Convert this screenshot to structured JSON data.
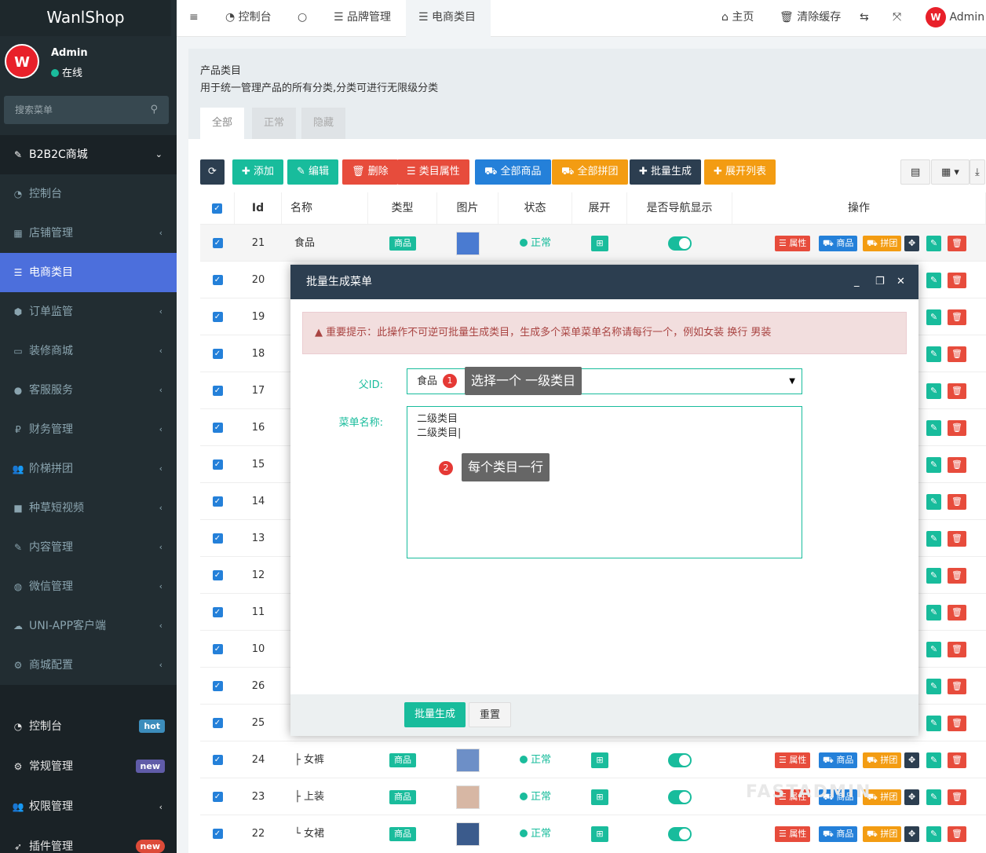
{
  "sidebar": {
    "logo": "WanlShop",
    "avatar_letter": "W",
    "user_name": "Admin",
    "user_status": "在线",
    "search_placeholder": "搜索菜单",
    "header_item": "B2B2C商城",
    "items": [
      {
        "label": "控制台",
        "icon": "dashboard-icon"
      },
      {
        "label": "店铺管理",
        "icon": "store-icon"
      },
      {
        "label": "电商类目",
        "icon": "list-icon",
        "active": true
      },
      {
        "label": "订单监管",
        "icon": "order-icon"
      },
      {
        "label": "装修商城",
        "icon": "monitor-icon"
      },
      {
        "label": "客服服务",
        "icon": "chat-icon"
      },
      {
        "label": "财务管理",
        "icon": "finance-icon"
      },
      {
        "label": "阶梯拼团",
        "icon": "group-icon"
      },
      {
        "label": "种草短视频",
        "icon": "video-icon"
      },
      {
        "label": "内容管理",
        "icon": "edit-icon"
      },
      {
        "label": "微信管理",
        "icon": "wechat-icon"
      },
      {
        "label": "UNI-APP客户端",
        "icon": "cloud-icon"
      },
      {
        "label": "商城配置",
        "icon": "gear-icon"
      }
    ],
    "lower_items": [
      {
        "label": "控制台",
        "badge": "hot",
        "badge_color": "#3c8dbc"
      },
      {
        "label": "常规管理",
        "badge": "new",
        "badge_color": "#605ca8"
      },
      {
        "label": "权限管理",
        "badge": "",
        "badge_color": ""
      },
      {
        "label": "插件管理",
        "badge": "new",
        "badge_color": "#dd4b39"
      }
    ]
  },
  "topbar": {
    "tabs": [
      "控制台",
      "",
      "品牌管理",
      "电商类目"
    ],
    "right": [
      "主页",
      "清除缓存"
    ],
    "user": "Admin"
  },
  "page": {
    "title": "产品类目",
    "description": "用于统一管理产品的所有分类,分类可进行无限级分类",
    "tabs": [
      "全部",
      "正常",
      "隐藏"
    ]
  },
  "toolbar": {
    "add": "添加",
    "edit": "编辑",
    "delete": "删除",
    "attr": "类目属性",
    "all_goods": "全部商品",
    "all_group": "全部拼团",
    "batch": "批量生成",
    "expand": "展开列表"
  },
  "table": {
    "headers": [
      "Id",
      "名称",
      "类型",
      "图片",
      "状态",
      "展开",
      "是否导航显示",
      "操作"
    ],
    "ops": {
      "attr": "属性",
      "goods": "商品",
      "group": "拼团"
    },
    "rows": [
      {
        "id": "21",
        "name": "食品",
        "type": "商品",
        "status": "正常"
      },
      {
        "id": "20",
        "name": "",
        "type": "",
        "status": ""
      },
      {
        "id": "19",
        "name": "",
        "type": "",
        "status": ""
      },
      {
        "id": "18",
        "name": "",
        "type": "",
        "status": ""
      },
      {
        "id": "17",
        "name": "",
        "type": "",
        "status": ""
      },
      {
        "id": "16",
        "name": "",
        "type": "",
        "status": ""
      },
      {
        "id": "15",
        "name": "",
        "type": "",
        "status": ""
      },
      {
        "id": "14",
        "name": "",
        "type": "",
        "status": ""
      },
      {
        "id": "13",
        "name": "",
        "type": "",
        "status": ""
      },
      {
        "id": "12",
        "name": "",
        "type": "",
        "status": ""
      },
      {
        "id": "11",
        "name": "",
        "type": "",
        "status": ""
      },
      {
        "id": "10",
        "name": "",
        "type": "",
        "status": ""
      },
      {
        "id": "26",
        "name": "",
        "type": "",
        "status": ""
      },
      {
        "id": "25",
        "name": "",
        "type": "",
        "status": ""
      },
      {
        "id": "24",
        "name": "├ 女裤",
        "type": "商品",
        "status": "正常"
      },
      {
        "id": "23",
        "name": "├ 上装",
        "type": "商品",
        "status": "正常"
      },
      {
        "id": "22",
        "name": "└ 女裙",
        "type": "商品",
        "status": "正常"
      }
    ]
  },
  "modal": {
    "title": "批量生成菜单",
    "alert": "重要提示：此操作不可逆可批量生成类目，生成多个菜单菜单名称请每行一个，例如女装 换行 男装",
    "parent_label": "父ID:",
    "parent_value": "食品",
    "name_label": "菜单名称:",
    "name_lines": [
      "二级类目",
      "二级类目"
    ],
    "tip1": "选择一个 一级类目",
    "tip2": "每个类目一行",
    "submit": "批量生成",
    "reset": "重置"
  },
  "watermark": "FASTADMIN"
}
